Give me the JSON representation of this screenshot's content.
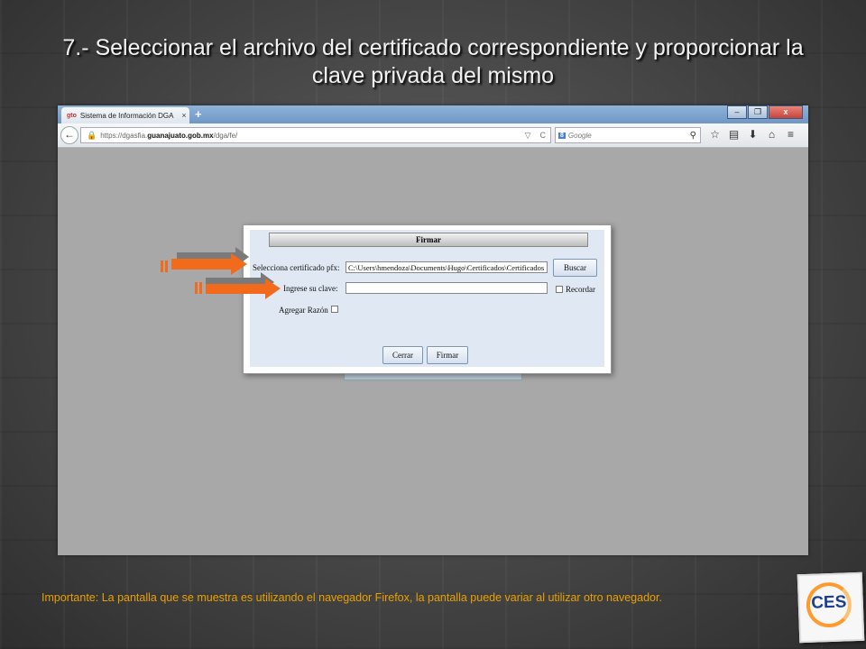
{
  "slide": {
    "title": "7.- Seleccionar el archivo del certificado correspondiente y proporcionar la clave privada del mismo",
    "footnote": "Importante: La pantalla que se muestra es utilizando el navegador Firefox, la pantalla puede variar al utilizar otro navegador.",
    "logo_text": "CES"
  },
  "browser": {
    "tab_favicon_text": "gto",
    "tab_title": "Sistema de Información DGA",
    "tab_close": "×",
    "new_tab": "+",
    "window_controls": {
      "minimize": "–",
      "restore": "❐",
      "close": "x"
    },
    "url_prefix": "https://dgasfia.",
    "url_domain": "guanajuato.gob.mx",
    "url_path": "/dga/fe/",
    "search_engine_badge": "8",
    "search_placeholder": "Google"
  },
  "dialog": {
    "title": "Firmar",
    "cert_label": "Selecciona certificado pfx:",
    "cert_value": "C:\\Users\\hmendoza\\Documents\\Hugo\\Certificados\\Certificados",
    "browse_button": "Buscar",
    "password_label": "Ingrese su clave:",
    "password_value": "",
    "remember_label": "Recordar",
    "reason_label": "Agregar Razón",
    "close_button": "Cerrar",
    "sign_button": "Firmar"
  },
  "colors": {
    "arrow_fill": "#f26b1d",
    "title_text": "#f2f2f2",
    "footnote_text": "#e8a000",
    "logo_blue": "#1c3f8f",
    "logo_orange": "#ff9a2e"
  }
}
